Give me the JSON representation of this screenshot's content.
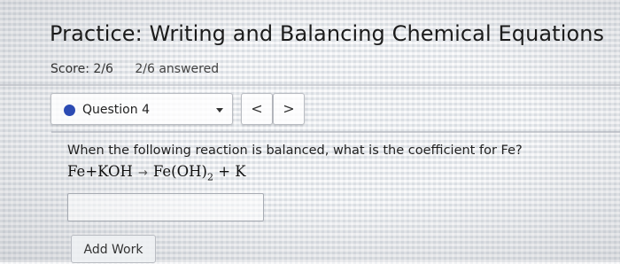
{
  "header": {
    "title": "Practice: Writing and Balancing Chemical Equations",
    "score": "Score: 2/6",
    "answered": "2/6 answered"
  },
  "question_nav": {
    "selected": "Question 4",
    "status_color": "#2c4bb3",
    "prev_label": "<",
    "next_label": ">"
  },
  "question": {
    "prompt": "When the following reaction is balanced, what is the coefficient for Fe?",
    "equation": {
      "reactant1": "Fe",
      "plus1": "+",
      "reactant2": "KOH",
      "arrow": "→",
      "product1": "Fe(OH)",
      "product1_subscript": "2",
      "plus2": "+",
      "product2": "K"
    },
    "answer_value": ""
  },
  "actions": {
    "add_work_label": "Add Work"
  }
}
